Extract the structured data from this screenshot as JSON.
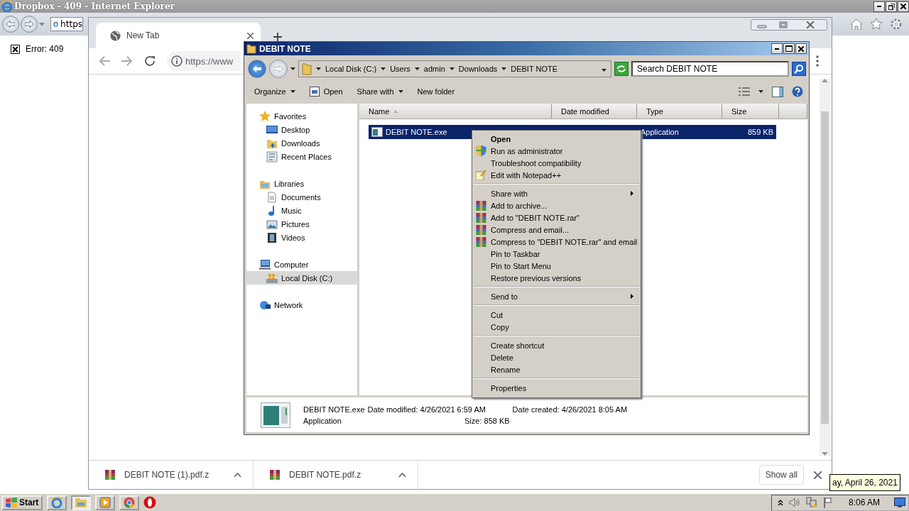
{
  "ie": {
    "title": "Dropbox - 409 - Internet Explorer",
    "address": "https",
    "error": "Error: 409"
  },
  "chrome": {
    "tabs": [
      {
        "label": "New Tab",
        "selected": true
      }
    ],
    "url": "https://www",
    "downloads": [
      {
        "name": "DEBIT NOTE (1).pdf.z"
      },
      {
        "name": "DEBIT NOTE.pdf.z"
      }
    ],
    "show_all": "Show all"
  },
  "explorer": {
    "title": "DEBIT NOTE",
    "breadcrumb": [
      "Local Disk (C:)",
      "Users",
      "admin",
      "Downloads",
      "DEBIT NOTE"
    ],
    "search_placeholder": "Search DEBIT NOTE",
    "toolbar": [
      {
        "label": "Organize",
        "kind": "menu"
      },
      {
        "label": "Open",
        "kind": "icon"
      },
      {
        "label": "Share with",
        "kind": "menu"
      },
      {
        "label": "New folder",
        "kind": "plain"
      }
    ],
    "nav": [
      {
        "label": "Favorites",
        "kind": "star",
        "selected": false,
        "children": [
          {
            "label": "Desktop",
            "kind": "desktop",
            "selected": false
          },
          {
            "label": "Downloads",
            "kind": "downloads",
            "selected": false
          },
          {
            "label": "Recent Places",
            "kind": "recent",
            "selected": false
          }
        ]
      },
      {
        "label": "Libraries",
        "kind": "libraries",
        "selected": false,
        "children": [
          {
            "label": "Documents",
            "kind": "document",
            "selected": false
          },
          {
            "label": "Music",
            "kind": "music",
            "selected": false
          },
          {
            "label": "Pictures",
            "kind": "pictures",
            "selected": false
          },
          {
            "label": "Videos",
            "kind": "videos",
            "selected": false
          }
        ]
      },
      {
        "label": "Computer",
        "kind": "computer",
        "selected": false,
        "children": [
          {
            "label": "Local Disk (C:)",
            "kind": "disk",
            "selected": true
          }
        ]
      },
      {
        "label": "Network",
        "kind": "network",
        "selected": false
      }
    ],
    "columns": [
      "Name",
      "Date modified",
      "Type",
      "Size"
    ],
    "files": [
      {
        "name": "DEBIT NOTE.exe",
        "type": "Application",
        "size": "859 KB",
        "selected": true
      }
    ],
    "details": {
      "name": "DEBIT NOTE.exe",
      "modified": "Date modified: 4/26/2021 6:59 AM",
      "created": "Date created: 4/26/2021 8:05 AM",
      "type": "Application",
      "size": "Size: 858 KB"
    }
  },
  "context_menu": [
    [
      {
        "label": "Open",
        "default": true,
        "kind": "none",
        "submenu": false
      },
      {
        "label": "Run as administrator",
        "default": false,
        "kind": "shield",
        "submenu": false
      },
      {
        "label": "Troubleshoot compatibility",
        "default": false,
        "kind": "none",
        "submenu": false
      },
      {
        "label": "Edit with Notepad++",
        "default": false,
        "kind": "notepad",
        "submenu": false
      }
    ],
    [
      {
        "label": "Share with",
        "default": false,
        "kind": "none",
        "submenu": true
      },
      {
        "label": "Add to archive...",
        "default": false,
        "kind": "archive",
        "submenu": false
      },
      {
        "label": "Add to \"DEBIT NOTE.rar\"",
        "default": false,
        "kind": "archive",
        "submenu": false
      },
      {
        "label": "Compress and email...",
        "default": false,
        "kind": "archive",
        "submenu": false
      },
      {
        "label": "Compress to \"DEBIT NOTE.rar\" and email",
        "default": false,
        "kind": "archive",
        "submenu": false
      },
      {
        "label": "Pin to Taskbar",
        "default": false,
        "kind": "none",
        "submenu": false
      },
      {
        "label": "Pin to Start Menu",
        "default": false,
        "kind": "none",
        "submenu": false
      },
      {
        "label": "Restore previous versions",
        "default": false,
        "kind": "none",
        "submenu": false
      }
    ],
    [
      {
        "label": "Send to",
        "default": false,
        "kind": "none",
        "submenu": true
      }
    ],
    [
      {
        "label": "Cut",
        "default": false,
        "kind": "none",
        "submenu": false
      },
      {
        "label": "Copy",
        "default": false,
        "kind": "none",
        "submenu": false
      }
    ],
    [
      {
        "label": "Create shortcut",
        "default": false,
        "kind": "none",
        "submenu": false
      },
      {
        "label": "Delete",
        "default": false,
        "kind": "none",
        "submenu": false
      },
      {
        "label": "Rename",
        "default": false,
        "kind": "none",
        "submenu": false
      }
    ],
    [
      {
        "label": "Properties",
        "default": false,
        "kind": "none",
        "submenu": false
      }
    ]
  ],
  "taskbar": {
    "start": "Start",
    "time": "8:06 AM",
    "tooltip": "ay, April 26, 2021"
  }
}
